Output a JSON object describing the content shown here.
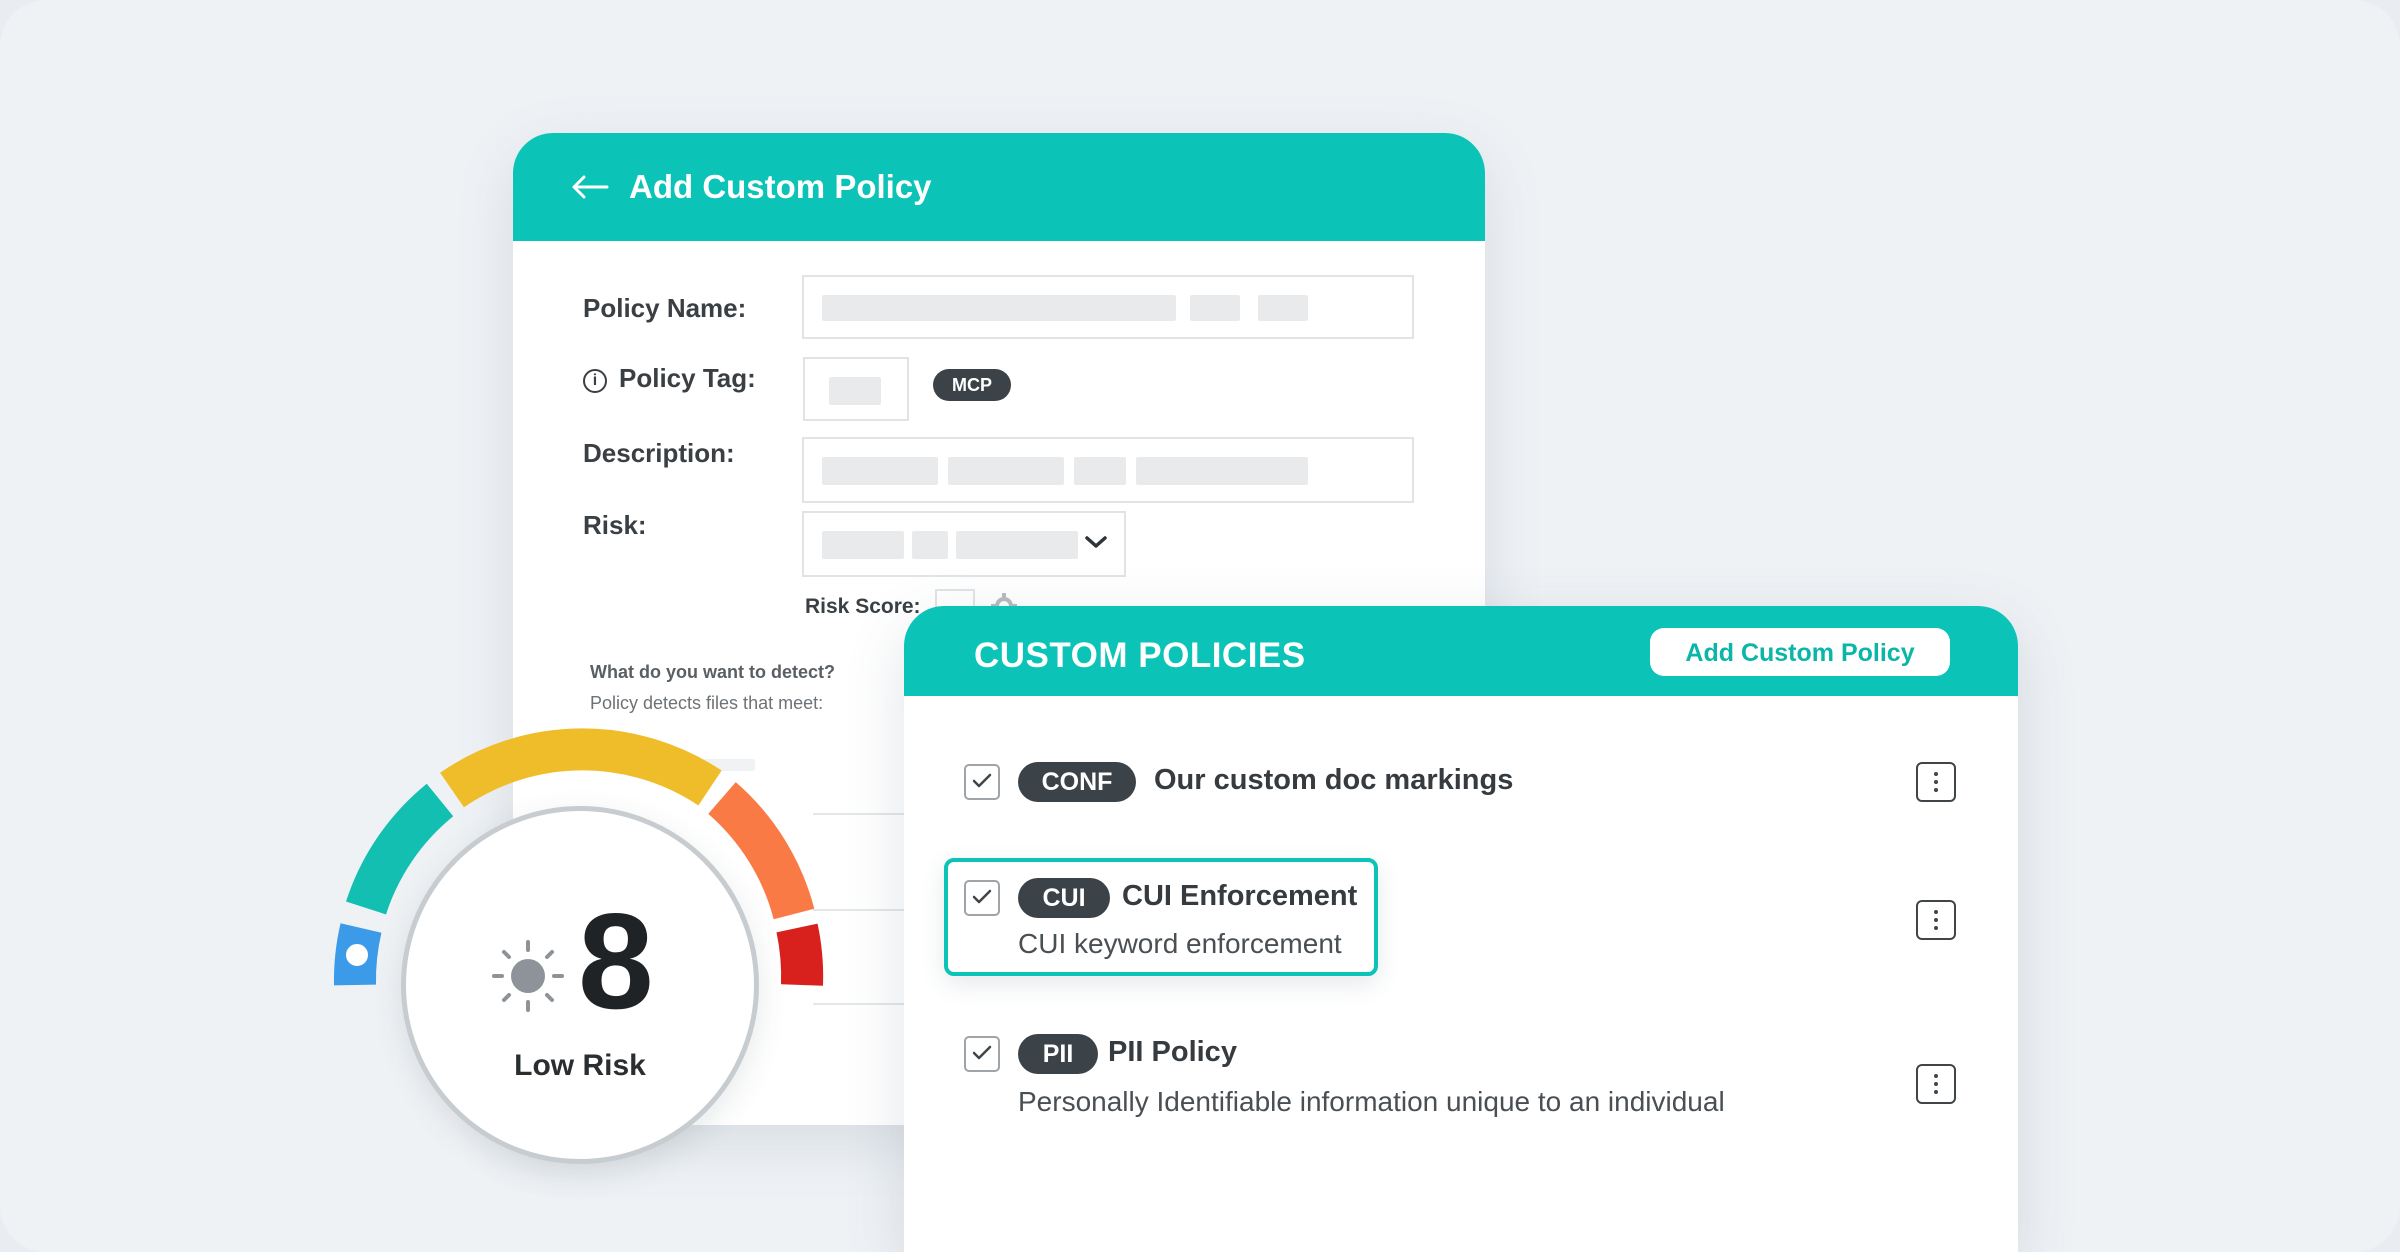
{
  "form": {
    "title": "Add Custom Policy",
    "policy_name_label": "Policy Name:",
    "policy_tag_label": "Policy Tag:",
    "policy_tag_badge": "MCP",
    "description_label": "Description:",
    "risk_label": "Risk:",
    "risk_score_label": "Risk Score:",
    "detect_question": "What do you want to detect?",
    "detect_subtitle": "Policy detects files that meet:",
    "icons": [
      "back-arrow-icon",
      "info-icon",
      "chevron-down-icon",
      "gear-icon"
    ]
  },
  "policies": {
    "title": "CUSTOM POLICIES",
    "add_button_label": "Add Custom Policy",
    "items": [
      {
        "tag": "CONF",
        "title": "Our custom doc markings",
        "description": "",
        "checked": true,
        "highlighted": false
      },
      {
        "tag": "CUI",
        "title": "CUI Enforcement",
        "description": "CUI keyword enforcement",
        "checked": true,
        "highlighted": true
      },
      {
        "tag": "PII",
        "title": "PII Policy",
        "description": "Personally Identifiable information unique to an individual",
        "checked": true,
        "highlighted": false
      }
    ]
  },
  "risk_gauge": {
    "score": "8",
    "level_label": "Low Risk",
    "colors": {
      "blue": "#3c9be8",
      "teal": "#12bfb0",
      "yellow": "#f0bd2a",
      "orange": "#fa7a45",
      "red": "#d8201d"
    }
  }
}
